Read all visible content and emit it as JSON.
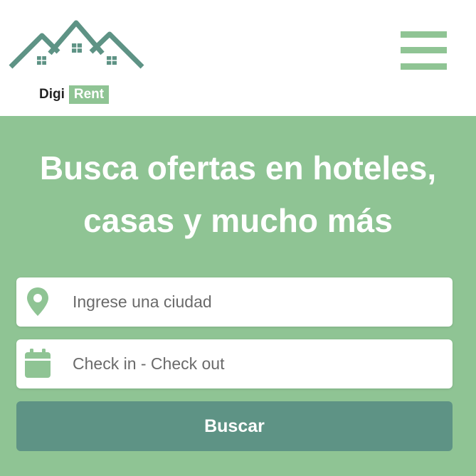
{
  "brand": {
    "name_part1": "Digi",
    "name_part2": "Rent",
    "primary_color": "#8fc494",
    "dark_color": "#5e9385"
  },
  "header": {
    "menu_icon": "hamburger-menu-icon"
  },
  "hero": {
    "headline_line1": "Busca ofertas en hoteles,",
    "headline_line2": "casas y mucho más"
  },
  "search": {
    "city_placeholder": "Ingrese una ciudad",
    "city_icon": "map-pin-icon",
    "dates_placeholder": "Check in - Check out",
    "dates_icon": "calendar-icon",
    "submit_label": "Buscar"
  }
}
